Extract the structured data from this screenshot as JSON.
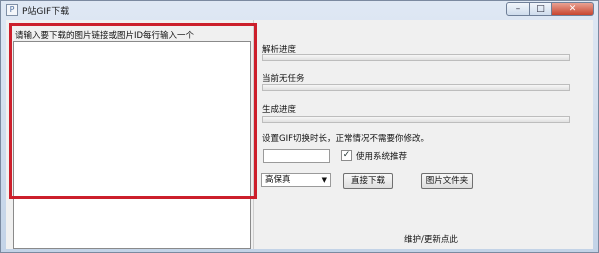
{
  "window": {
    "title": "P站GIF下载",
    "minimize_glyph": "–",
    "maximize_glyph": "□",
    "close_glyph": "✕"
  },
  "left_pane": {
    "prompt": "请输入要下载的图片链接或图片ID每行输入一个",
    "input_value": ""
  },
  "parse_progress": {
    "label": "解析进度",
    "value": 0.0
  },
  "task": {
    "label": "当前无任务",
    "value": 0.0
  },
  "generate_progress": {
    "label": "生成进度",
    "value": 0.0
  },
  "interval": {
    "label": "设置GIF切换时长，正常情况不需要你修改。",
    "value": "",
    "use_system_recommend": {
      "label": "使用系统推荐",
      "checked": true
    }
  },
  "quality_select": {
    "selected": "高保真"
  },
  "buttons": {
    "download": "直接下载",
    "image_folder": "图片文件夹"
  },
  "maintenance_link": "维护/更新点此",
  "icons": {
    "app": "app-icon",
    "check": "check-icon",
    "dropdown": "chevron-down-icon"
  },
  "colors": {
    "highlight": "#cc1f2b",
    "close_button": "#c8452f"
  }
}
